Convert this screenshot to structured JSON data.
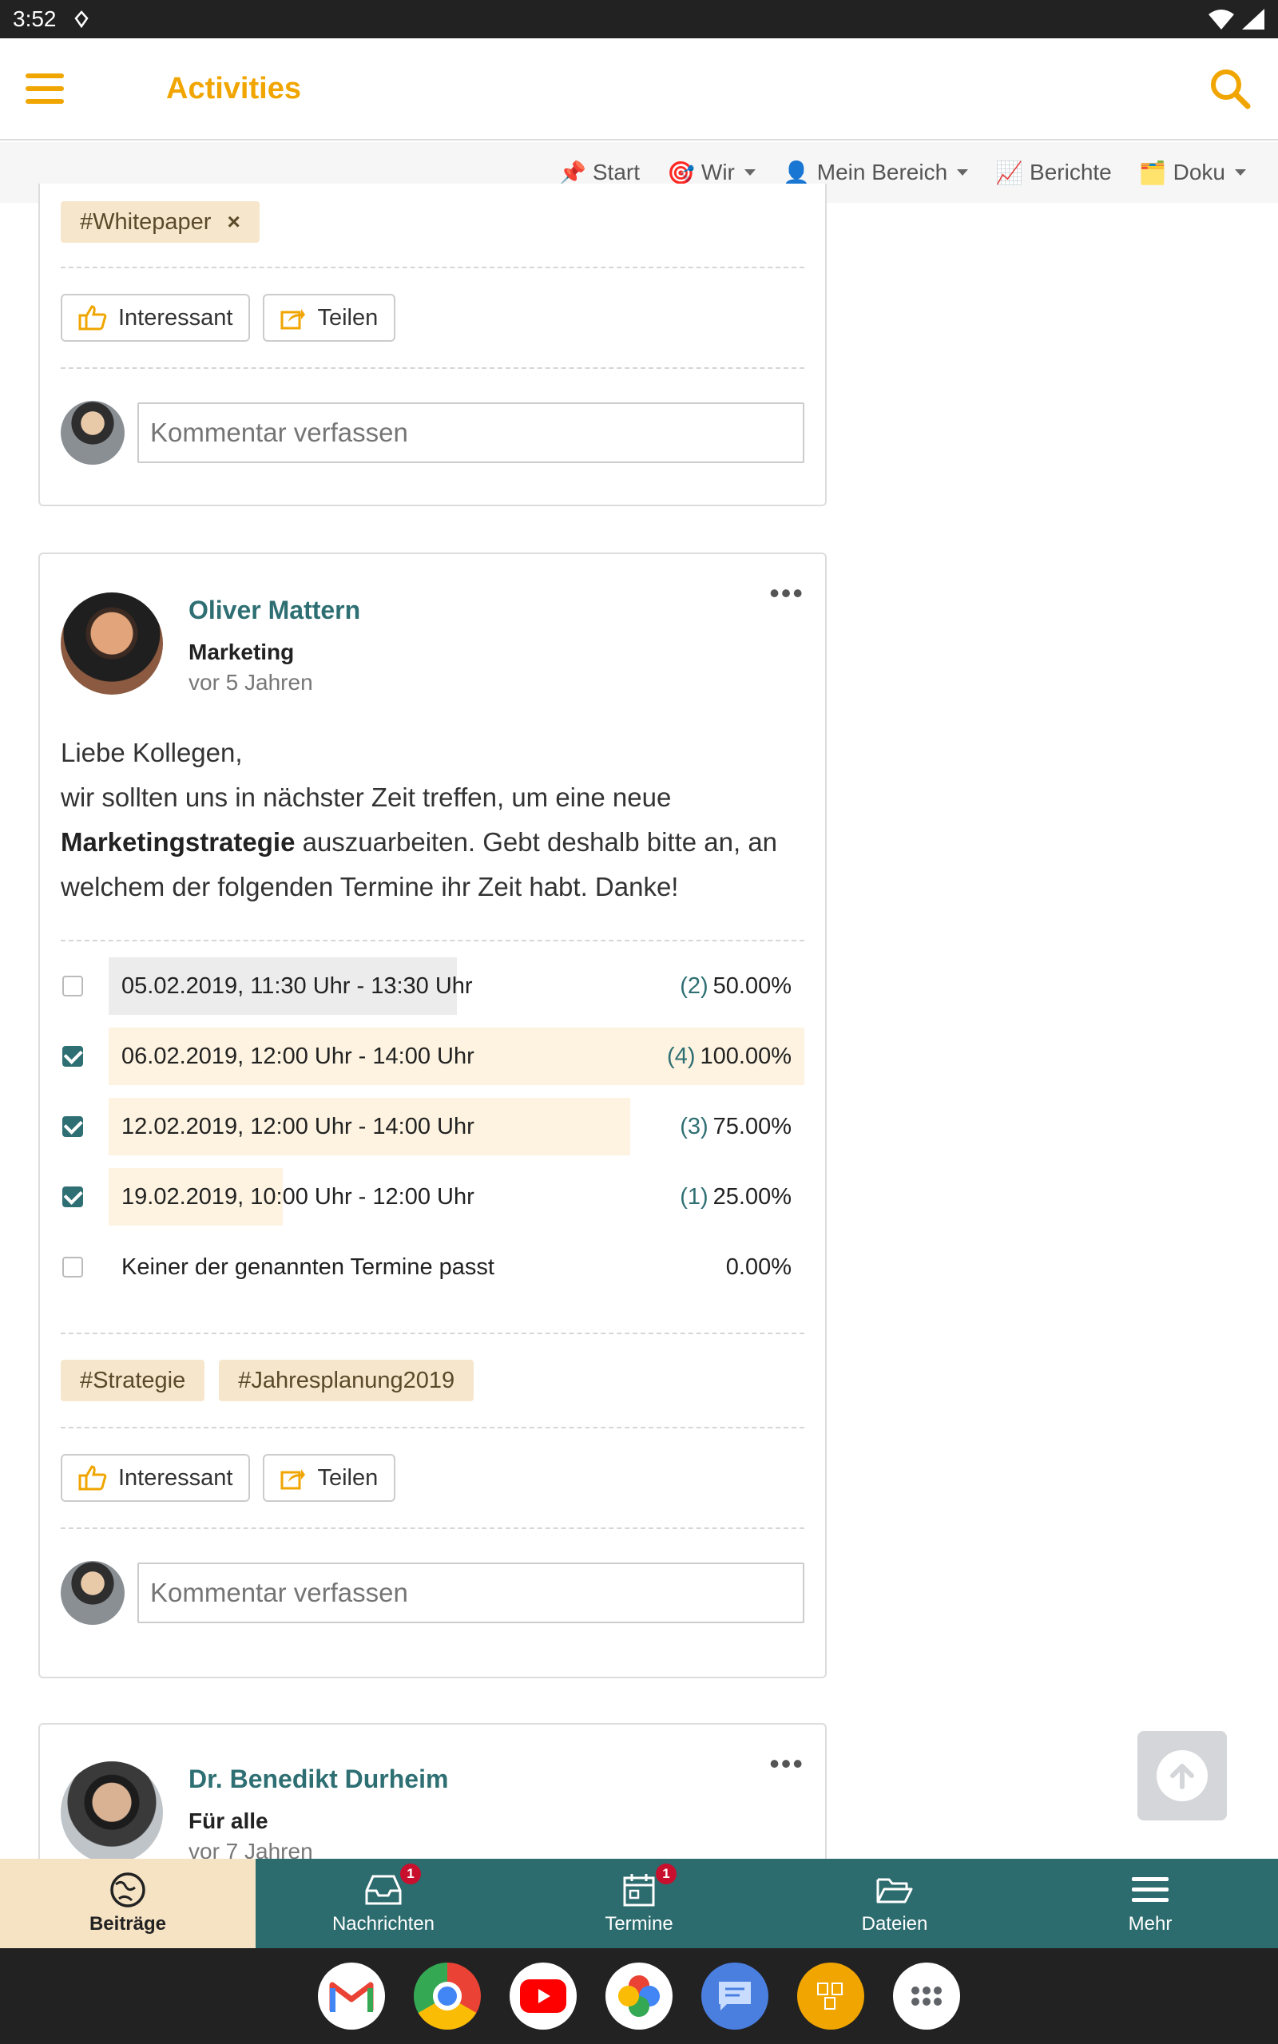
{
  "status": {
    "time": "3:52"
  },
  "appbar": {
    "title": "Activities"
  },
  "topnav": [
    {
      "emoji": "📌",
      "label": "Start",
      "dropdown": false
    },
    {
      "emoji": "🎯",
      "label": "Wir",
      "dropdown": true
    },
    {
      "emoji": "👤",
      "label": "Mein Bereich",
      "dropdown": true
    },
    {
      "emoji": "📈",
      "label": "Berichte",
      "dropdown": false
    },
    {
      "emoji": "🗂️",
      "label": "Doku",
      "dropdown": true
    }
  ],
  "card1": {
    "tag": "#Whitepaper",
    "like_label": "Interessant",
    "share_label": "Teilen",
    "comment_placeholder": "Kommentar verfassen"
  },
  "post2": {
    "author": "Oliver Mattern",
    "audience": "Marketing",
    "time": "vor 5 Jahren",
    "body_line1": "Liebe Kollegen,",
    "body_line2": "wir sollten uns in nächster Zeit treffen, um eine neue",
    "body_bold": "Marketingstrategie",
    "body_line3": " auszuarbeiten. Gebt deshalb bitte an, an welchem der folgenden Termine ihr Zeit habt. Danke!",
    "poll": [
      {
        "label": "05.02.2019, 11:30 Uhr - 13:30 Uhr",
        "count": "(2)",
        "percent": "50.00%",
        "fraction": 0.5,
        "checked": false,
        "bar": "#ececec"
      },
      {
        "label": "06.02.2019, 12:00 Uhr - 14:00 Uhr",
        "count": "(4)",
        "percent": "100.00%",
        "fraction": 1.0,
        "checked": true,
        "bar": "#fdf3e0"
      },
      {
        "label": "12.02.2019, 12:00 Uhr - 14:00 Uhr",
        "count": "(3)",
        "percent": "75.00%",
        "fraction": 0.75,
        "checked": true,
        "bar": "#fdf3e0"
      },
      {
        "label": "19.02.2019, 10:00 Uhr - 12:00 Uhr",
        "count": "(1)",
        "percent": "25.00%",
        "fraction": 0.25,
        "checked": true,
        "bar": "#fdf3e0"
      },
      {
        "label": "Keiner der genannten Termine passt",
        "count": "",
        "percent": "0.00%",
        "fraction": 0,
        "checked": false,
        "bar": "#ffffff"
      }
    ],
    "tags": [
      "#Strategie",
      "#Jahresplanung2019"
    ],
    "like_label": "Interessant",
    "share_label": "Teilen",
    "comment_placeholder": "Kommentar verfassen"
  },
  "post3": {
    "author": "Dr. Benedikt Durheim",
    "audience": "Für alle",
    "time": "vor 7 Jahren"
  },
  "bottomnav": [
    {
      "label": "Beiträge",
      "icon": "globe-icon",
      "badge": "",
      "active": true
    },
    {
      "label": "Nachrichten",
      "icon": "inbox-icon",
      "badge": "1",
      "active": false
    },
    {
      "label": "Termine",
      "icon": "calendar-icon",
      "badge": "1",
      "active": false
    },
    {
      "label": "Dateien",
      "icon": "folder-icon",
      "badge": "",
      "active": false
    },
    {
      "label": "Mehr",
      "icon": "menu-icon",
      "badge": "",
      "active": false
    }
  ],
  "dock": [
    "gmail-icon",
    "chrome-icon",
    "youtube-icon",
    "photos-icon",
    "messages-icon",
    "app-icon",
    "app-drawer-icon"
  ],
  "colors": {
    "accent": "#f0a500",
    "teal": "#2c6b6e",
    "tag_bg": "#f6e7cc"
  }
}
